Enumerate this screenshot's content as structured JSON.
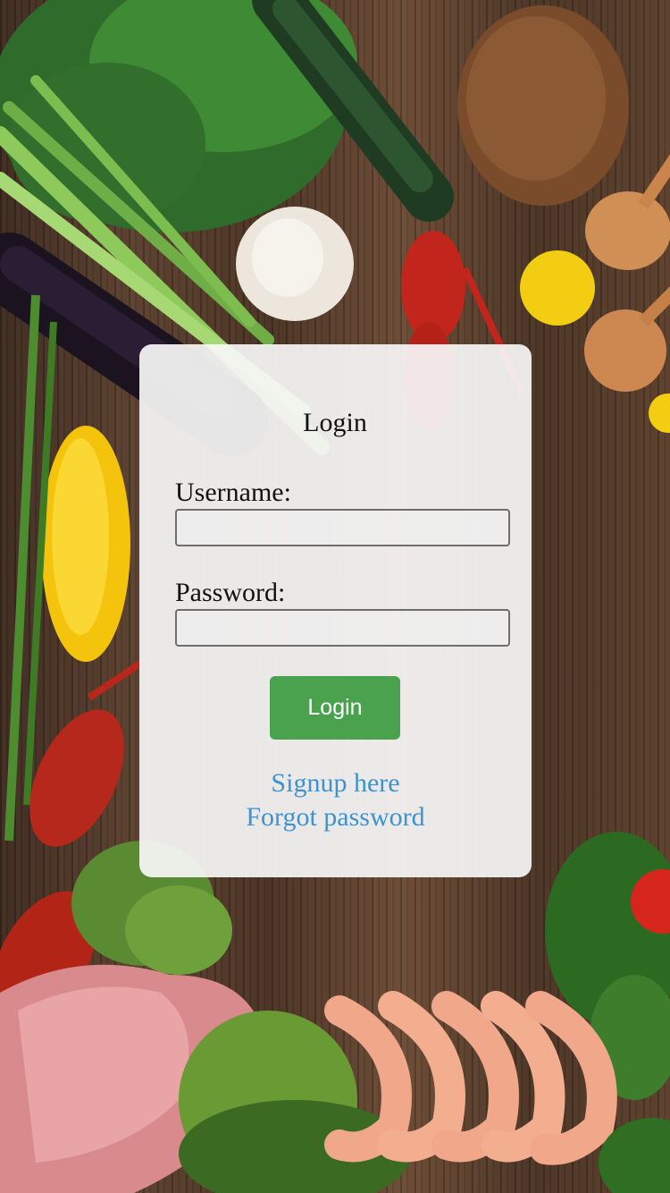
{
  "card": {
    "title": "Login",
    "username_label": "Username:",
    "username_value": "",
    "password_label": "Password:",
    "password_value": "",
    "login_button": "Login",
    "signup_link": "Signup here",
    "forgot_link": "Forgot password"
  },
  "colors": {
    "button": "#4aa24f",
    "link": "#3d92cf",
    "card": "rgba(246,246,246,0.93)"
  }
}
